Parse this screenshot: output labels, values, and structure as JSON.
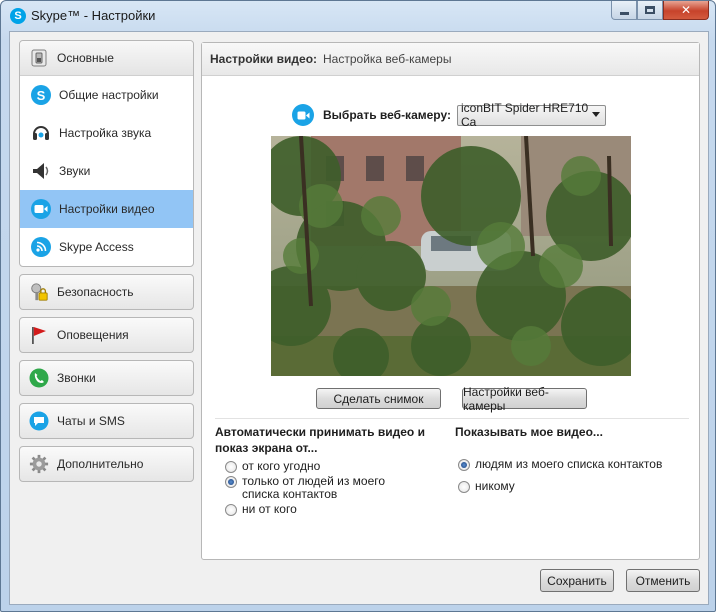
{
  "window": {
    "title": "Skype™ - Настройки"
  },
  "sidebar": {
    "group_header": "Основные",
    "items": [
      {
        "label": "Общие настройки",
        "icon": "skype-icon",
        "selected": false
      },
      {
        "label": "Настройка звука",
        "icon": "headset-icon",
        "selected": false
      },
      {
        "label": "Звуки",
        "icon": "speaker-icon",
        "selected": false
      },
      {
        "label": "Настройки видео",
        "icon": "camera-icon",
        "selected": true
      },
      {
        "label": "Skype Access",
        "icon": "wifi-icon",
        "selected": false
      }
    ],
    "sections": [
      {
        "label": "Безопасность",
        "icon": "lock-icon"
      },
      {
        "label": "Оповещения",
        "icon": "flag-icon"
      },
      {
        "label": "Звонки",
        "icon": "phone-icon"
      },
      {
        "label": "Чаты и SMS",
        "icon": "chat-icon"
      },
      {
        "label": "Дополнительно",
        "icon": "gear-icon"
      }
    ]
  },
  "main": {
    "header_bold": "Настройки видео:",
    "header_sub": "Настройка веб-камеры",
    "camera_label": "Выбрать веб-камеру:",
    "camera_value": "iconBIT Spider HRE710 Ca",
    "snapshot_button": "Сделать снимок",
    "webcam_settings_button": "Настройки веб-камеры",
    "auto_accept": {
      "title": "Автоматически принимать видео и показ экрана от...",
      "options": [
        {
          "label": "от кого угодно",
          "checked": false
        },
        {
          "label": "только от людей из моего списка контактов",
          "checked": true
        },
        {
          "label": "ни от кого",
          "checked": false
        }
      ]
    },
    "show_video": {
      "title": "Показывать мое видео...",
      "options": [
        {
          "label": "людям из моего списка контактов",
          "checked": true
        },
        {
          "label": "никому",
          "checked": false
        }
      ]
    }
  },
  "footer": {
    "save": "Сохранить",
    "cancel": "Отменить"
  },
  "colors": {
    "accent": "#1aa3e6",
    "selected_row": "#92c5f5",
    "close_button": "#c7432b"
  }
}
